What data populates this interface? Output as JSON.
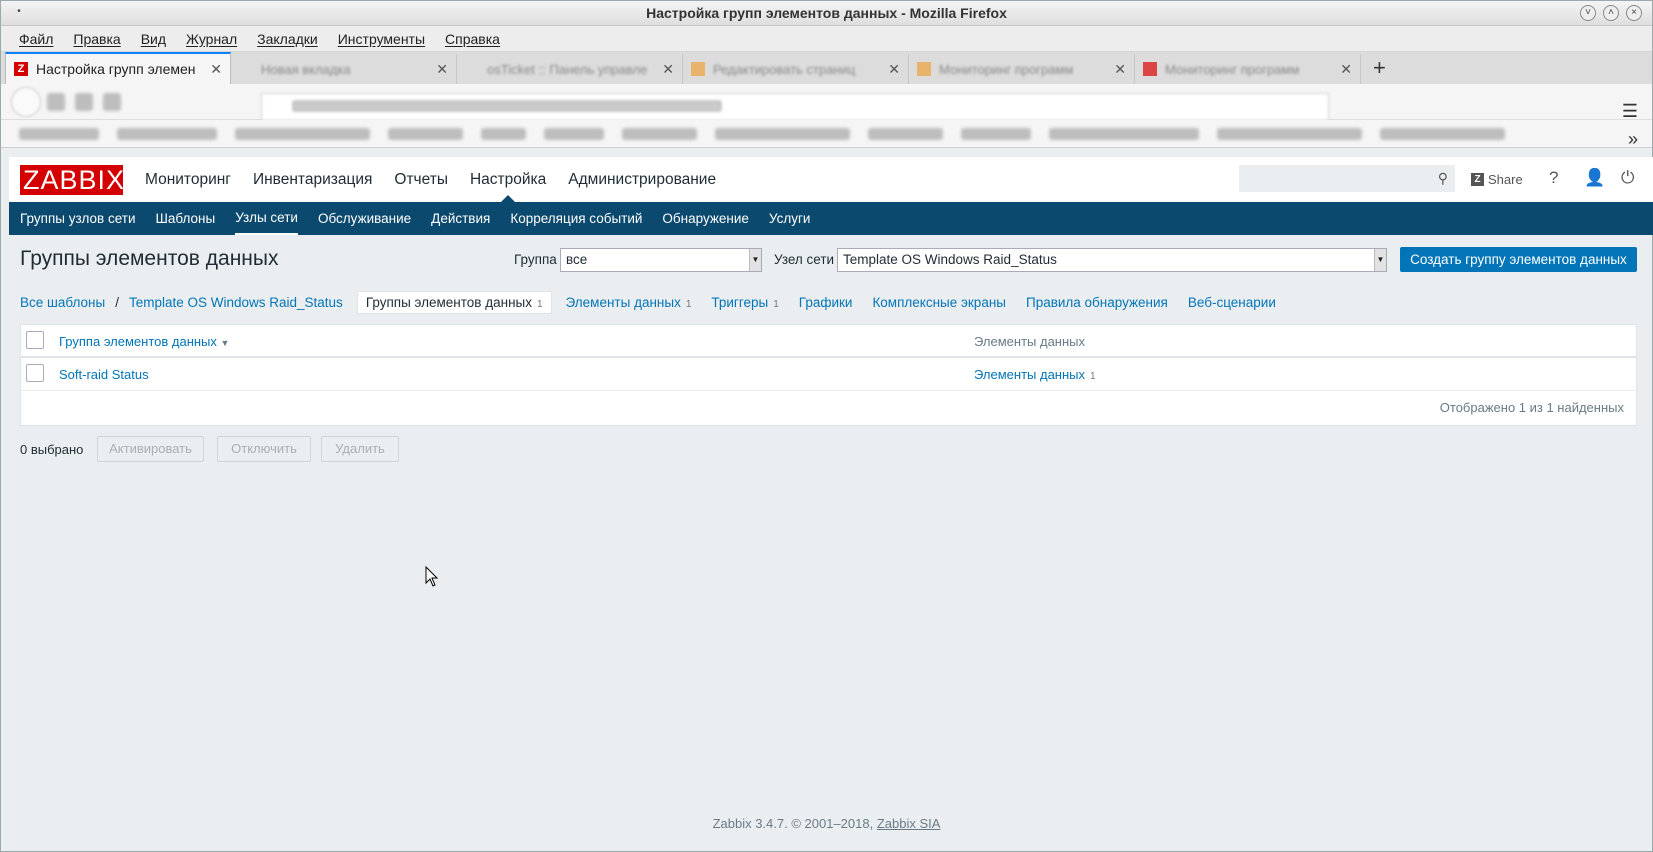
{
  "window": {
    "title": "Настройка групп элементов данных - Mozilla Firefox"
  },
  "menubar": [
    "Файл",
    "Правка",
    "Вид",
    "Журнал",
    "Закладки",
    "Инструменты",
    "Справка"
  ],
  "tabs": [
    {
      "label": "Настройка групп элемен",
      "active": true
    },
    {
      "label": "Новая вкладка"
    },
    {
      "label": "osTicket :: Панель управле"
    },
    {
      "label": "Редактировать страниц"
    },
    {
      "label": "Мониторинг программ"
    },
    {
      "label": "Мониторинг программ"
    }
  ],
  "zabbix": {
    "logo": "ZABBIX",
    "topnav": [
      "Мониторинг",
      "Инвентаризация",
      "Отчеты",
      "Настройка",
      "Администрирование"
    ],
    "topnav_selected": "Настройка",
    "share": "Share",
    "help": "?",
    "subnav": [
      "Группы узлов сети",
      "Шаблоны",
      "Узлы сети",
      "Обслуживание",
      "Действия",
      "Корреляция событий",
      "Обнаружение",
      "Услуги"
    ],
    "subnav_selected": "Узлы сети"
  },
  "page": {
    "title": "Группы элементов данных",
    "filter_group_label": "Группа",
    "filter_group_value": "все",
    "filter_host_label": "Узел сети",
    "filter_host_value": "Template OS Windows Raid_Status",
    "create_button": "Создать группу элементов данных"
  },
  "breadcrumbs": {
    "all_templates": "Все шаблоны",
    "separator": "/",
    "template": "Template OS Windows Raid_Status",
    "current": "Группы элементов данных",
    "current_count": "1",
    "items": "Элементы данных",
    "items_count": "1",
    "triggers": "Триггеры",
    "triggers_count": "1",
    "graphs": "Графики",
    "screens": "Комплексные экраны",
    "discovery": "Правила обнаружения",
    "web": "Веб-сценарии"
  },
  "table": {
    "col_name": "Группа элементов данных",
    "col_items": "Элементы данных",
    "rows": [
      {
        "name": "Soft-raid Status",
        "items_label": "Элементы данных",
        "items_count": "1"
      }
    ],
    "footer": "Отображено 1 из 1 найденных"
  },
  "actions": {
    "selected": "0 выбрано",
    "activate": "Активировать",
    "disable": "Отключить",
    "delete": "Удалить"
  },
  "footer": {
    "text": "Zabbix 3.4.7. © 2001–2018,",
    "link": "Zabbix SIA"
  }
}
